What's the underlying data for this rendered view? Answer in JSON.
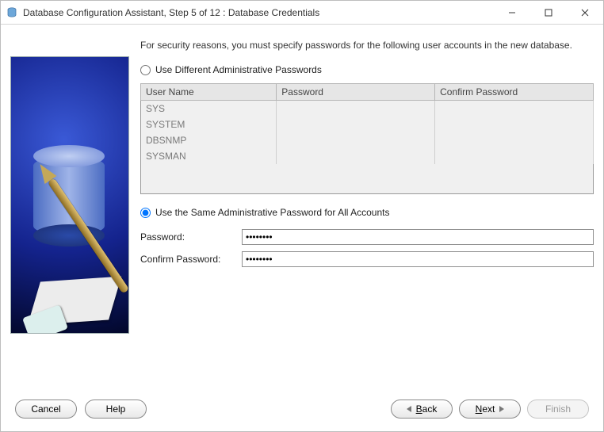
{
  "window": {
    "title": "Database Configuration Assistant, Step 5 of 12 : Database Credentials"
  },
  "intro": "For security reasons, you must specify passwords for the following user accounts in the new database.",
  "options": {
    "different_label": "Use Different Administrative Passwords",
    "same_label": "Use the Same Administrative Password for All Accounts",
    "selected": "same"
  },
  "table": {
    "columns": [
      "User Name",
      "Password",
      "Confirm Password"
    ],
    "rows": [
      {
        "user": "SYS",
        "password": "",
        "confirm": ""
      },
      {
        "user": "SYSTEM",
        "password": "",
        "confirm": ""
      },
      {
        "user": "DBSNMP",
        "password": "",
        "confirm": ""
      },
      {
        "user": "SYSMAN",
        "password": "",
        "confirm": ""
      }
    ]
  },
  "fields": {
    "password_label": "Password:",
    "confirm_label": "Confirm Password:",
    "password_value": "********",
    "confirm_value": "********"
  },
  "buttons": {
    "cancel": "Cancel",
    "help": "Help",
    "back": "Back",
    "next": "Next",
    "finish": "Finish",
    "back_hotkey": "B",
    "next_hotkey": "N"
  }
}
